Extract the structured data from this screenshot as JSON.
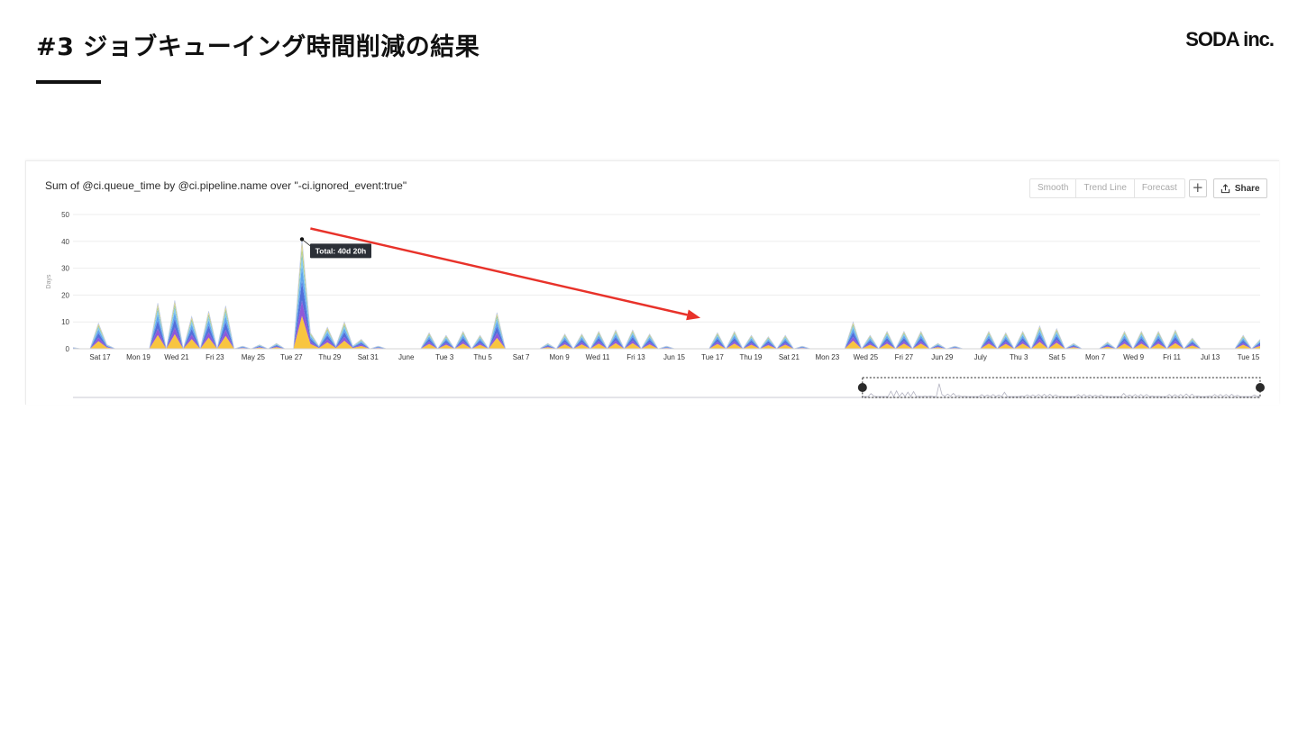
{
  "slide": {
    "title": "#3 ジョブキューイング時間削減の結果",
    "logo": "SODA inc."
  },
  "panel": {
    "title": "Sum of @ci.queue_time by @ci.pipeline.name over \"-ci.ignored_event:true\"",
    "toolbar": {
      "smooth_label": "Smooth",
      "trend_label": "Trend Line",
      "forecast_label": "Forecast",
      "plus_label": "+",
      "share_label": "Share",
      "share_icon": "share-icon"
    }
  },
  "colors": {
    "accent_arrow": "#e8322a",
    "series_base": "#f8c236",
    "tooltip_bg": "#2b2f36"
  },
  "chart_data": {
    "type": "area",
    "stacked": true,
    "ylabel": "Days",
    "ylim": [
      0,
      50
    ],
    "yticks": [
      0,
      10,
      20,
      30,
      40,
      50
    ],
    "grid": true,
    "x_tick_labels": [
      "Sat 17",
      "Mon 19",
      "Wed 21",
      "Fri 23",
      "May 25",
      "Tue 27",
      "Thu 29",
      "Sat 31",
      "June",
      "Tue 3",
      "Thu 5",
      "Sat 7",
      "Mon 9",
      "Wed 11",
      "Fri 13",
      "Jun 15",
      "Tue 17",
      "Thu 19",
      "Sat 21",
      "Mon 23",
      "Wed 25",
      "Fri 27",
      "Jun 29",
      "July",
      "Thu 3",
      "Sat 5",
      "Mon 7",
      "Wed 9",
      "Fri 11",
      "Jul 13",
      "Tue 15"
    ],
    "totals_by_half_day": [
      0.5,
      0,
      0,
      9.5,
      1.5,
      0,
      0,
      0,
      0,
      0,
      17,
      0,
      18,
      0,
      12,
      0,
      14,
      0,
      16,
      0,
      1,
      0,
      1.5,
      0,
      2,
      0,
      0,
      40.8,
      6,
      1,
      8,
      1,
      10,
      1,
      3.5,
      0,
      1,
      0,
      0,
      0,
      0,
      0,
      6,
      0,
      5,
      0,
      6.5,
      0,
      5,
      0,
      13.5,
      0,
      0,
      0,
      0,
      0,
      2,
      0,
      5.5,
      0,
      5.5,
      0,
      6.5,
      0,
      7,
      0,
      7,
      0,
      5.5,
      0,
      1,
      0,
      0,
      0,
      0,
      0,
      6,
      0,
      6.5,
      0,
      5,
      0,
      4.5,
      0,
      5,
      0,
      1,
      0,
      0,
      0,
      0,
      0,
      10,
      0,
      5,
      0,
      6.5,
      0,
      6.5,
      0,
      6.5,
      0,
      2,
      0,
      1,
      0,
      0,
      0,
      6.5,
      0,
      6,
      0,
      6.5,
      0,
      8.5,
      0,
      7.5,
      0,
      2,
      0,
      0,
      0,
      2.5,
      0,
      6.5,
      0,
      6.5,
      0,
      6.5,
      0,
      7,
      0,
      4,
      0,
      0,
      0,
      0,
      0,
      5,
      0,
      3.5
    ],
    "series_shares": [
      {
        "color": "#f8c236",
        "share": 0.3
      },
      {
        "color": "#8a4fd6",
        "share": 0.14
      },
      {
        "color": "#4a67d8",
        "share": 0.18
      },
      {
        "color": "#5aa0ec",
        "share": 0.14
      },
      {
        "color": "#7fc9ee",
        "share": 0.1
      },
      {
        "color": "#8bbf8a",
        "share": 0.06
      },
      {
        "color": "#f4de6a",
        "share": 0.08
      }
    ],
    "annotation": {
      "tooltip": "Total: 40d 20h",
      "peak_index": 27,
      "peak_value": 40.8
    },
    "arrow_annotation": {
      "from_index": 28,
      "from_value": 44.8,
      "to_index": 74,
      "to_value": 11.5
    },
    "navigator": {
      "selected_range_fraction": [
        0.665,
        1.0
      ]
    }
  }
}
